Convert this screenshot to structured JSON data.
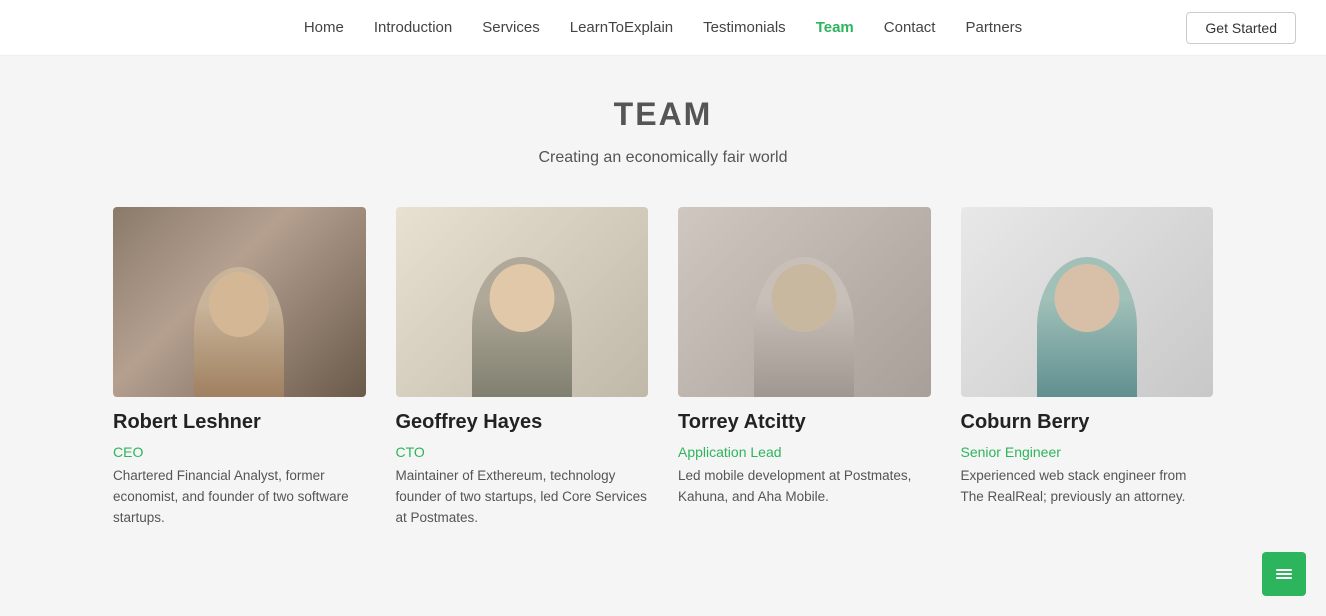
{
  "nav": {
    "links": [
      {
        "id": "home",
        "label": "Home",
        "active": false
      },
      {
        "id": "introduction",
        "label": "Introduction",
        "active": false
      },
      {
        "id": "services",
        "label": "Services",
        "active": false
      },
      {
        "id": "learntoexplain",
        "label": "LearnToExplain",
        "active": false
      },
      {
        "id": "testimonials",
        "label": "Testimonials",
        "active": false
      },
      {
        "id": "team",
        "label": "Team",
        "active": true
      },
      {
        "id": "contact",
        "label": "Contact",
        "active": false
      },
      {
        "id": "partners",
        "label": "Partners",
        "active": false
      }
    ],
    "cta_label": "Get Started"
  },
  "section": {
    "title": "TEAM",
    "subtitle": "Creating an economically fair world"
  },
  "team": [
    {
      "id": "robert-leshner",
      "name": "Robert Leshner",
      "role": "CEO",
      "bio": "Chartered Financial Analyst, former economist, and founder of two software startups.",
      "avatar_class": "avatar-robert"
    },
    {
      "id": "geoffrey-hayes",
      "name": "Geoffrey Hayes",
      "role": "CTO",
      "bio": "Maintainer of Exthereum, technology founder of two startups, led Core Services at Postmates.",
      "avatar_class": "avatar-geoffrey"
    },
    {
      "id": "torrey-atcitty",
      "name": "Torrey Atcitty",
      "role": "Application Lead",
      "bio": "Led mobile development at Postmates, Kahuna, and Aha Mobile.",
      "avatar_class": "avatar-torrey"
    },
    {
      "id": "coburn-berry",
      "name": "Coburn Berry",
      "role": "Senior Engineer",
      "bio": "Experienced web stack engineer from The RealReal; previously an attorney.",
      "avatar_class": "avatar-coburn"
    }
  ],
  "colors": {
    "active_nav": "#2db55d",
    "role_color": "#2db55d"
  }
}
